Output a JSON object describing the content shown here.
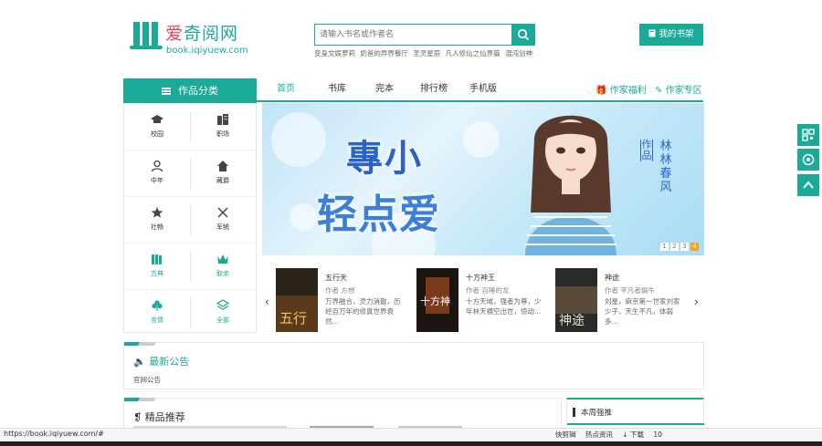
{
  "site": {
    "logo_name_red": "爱",
    "logo_name_rest": "奇阅网",
    "logo_domain": "book.iqiyuew.com"
  },
  "search": {
    "placeholder": "请输入书名或作者名",
    "hotwords": [
      "变身文娱萝莉",
      "奶爸的异界餐厅",
      "圣灵星辰",
      "凡人修仙之仙界篇",
      "混沌剑神"
    ]
  },
  "header": {
    "shelf_label": "我的书架"
  },
  "nav": {
    "category_label": "作品分类",
    "items": [
      "首页",
      "书库",
      "完本",
      "排行榜",
      "手机版"
    ],
    "author_welfare": "作家福利",
    "author_zone": "作家专区"
  },
  "categories": [
    {
      "label": "校园",
      "icon": "graduation-cap-icon"
    },
    {
      "label": "职场",
      "icon": "buildings-icon"
    },
    {
      "label": "中年",
      "icon": "person-icon"
    },
    {
      "label": "藏爵",
      "icon": "home-icon"
    },
    {
      "label": "社畅",
      "icon": "star-icon"
    },
    {
      "label": "军统",
      "icon": "crossed-swords-icon"
    },
    {
      "label": "古典",
      "icon": "books-icon"
    },
    {
      "label": "取余",
      "icon": "crown-icon"
    },
    {
      "label": "言情",
      "icon": "clover-icon"
    },
    {
      "label": "全部",
      "icon": "layers-icon"
    }
  ],
  "banner": {
    "title_line1": "專小",
    "title_line2": "轻点爱",
    "tag": "作品",
    "author": "林林春风",
    "pages": [
      "1",
      "2",
      "3",
      "4"
    ],
    "active_page": "4"
  },
  "books": [
    {
      "title": "五行天",
      "author": "作者  方想",
      "desc": "万界融合，灵力消散，历经百万年的修真世界衰然..."
    },
    {
      "title": "十方神王",
      "author": "作者  百睡的龙",
      "desc": "十方天域，强者为尊，少年林天横空出世，惊动..."
    },
    {
      "title": "神途",
      "author": "作者  平凡者蜗牛",
      "desc": "刘星，麻京第一世家刘家少子，天生不凡，体弱多..."
    }
  ],
  "notice": {
    "title": "最新公告",
    "item": "官网公告"
  },
  "recommend": {
    "title": "精品推荐"
  },
  "weekly": {
    "title": "本周强推"
  },
  "status": {
    "url": "https://book.iqiyuew.com/#",
    "items": [
      "快剪辑",
      "热点资讯",
      "↓ 下载",
      "10"
    ]
  },
  "colors": {
    "accent": "#1aaa97",
    "active_dot": "#f4a31c",
    "logo_red": "#e5455b"
  }
}
